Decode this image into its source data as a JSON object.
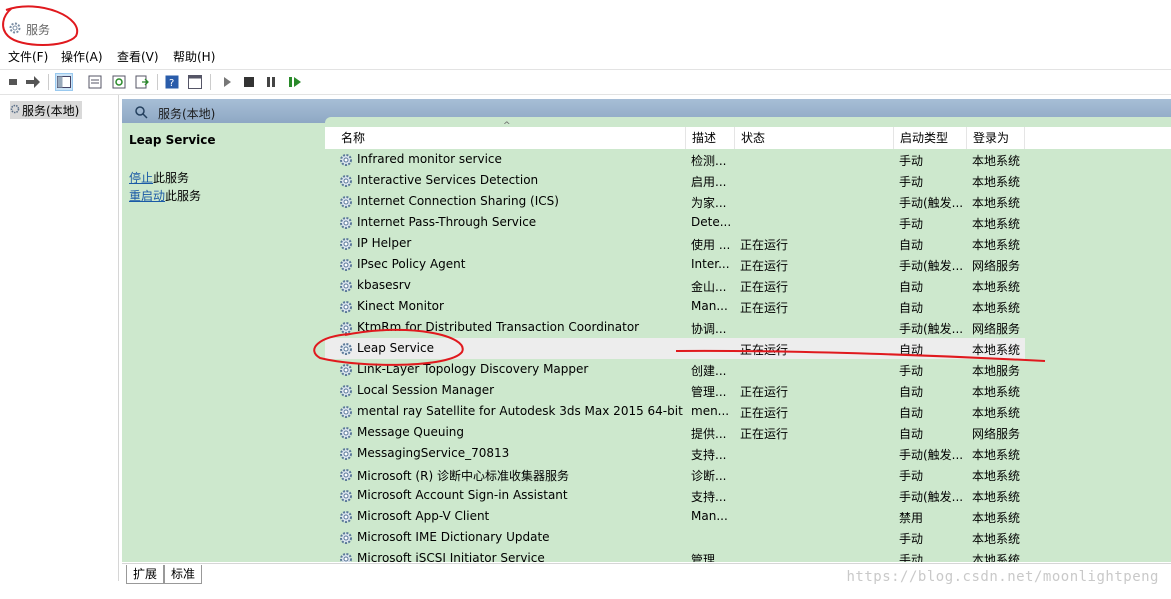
{
  "window": {
    "title": "服务"
  },
  "menu": [
    "文件(F)",
    "操作(A)",
    "查看(V)",
    "帮助(H)"
  ],
  "tree": {
    "root": "服务(本地)"
  },
  "panel": {
    "header": "服务(本地)"
  },
  "description": {
    "service_name": "Leap Service",
    "stop_link": "停止",
    "stop_suffix": "此服务",
    "restart_link": "重启动",
    "restart_suffix": "此服务"
  },
  "columns": {
    "name": "名称",
    "desc": "描述",
    "status": "状态",
    "startup": "启动类型",
    "logon": "登录为"
  },
  "services": [
    {
      "name": "Infrared monitor service",
      "desc": "检测...",
      "status": "",
      "startup": "手动",
      "logon": "本地系统"
    },
    {
      "name": "Interactive Services Detection",
      "desc": "启用...",
      "status": "",
      "startup": "手动",
      "logon": "本地系统"
    },
    {
      "name": "Internet Connection Sharing (ICS)",
      "desc": "为家...",
      "status": "",
      "startup": "手动(触发...",
      "logon": "本地系统"
    },
    {
      "name": "Internet Pass-Through Service",
      "desc": "Dete...",
      "status": "",
      "startup": "手动",
      "logon": "本地系统"
    },
    {
      "name": "IP Helper",
      "desc": "使用 ...",
      "status": "正在运行",
      "startup": "自动",
      "logon": "本地系统"
    },
    {
      "name": "IPsec Policy Agent",
      "desc": "Inter...",
      "status": "正在运行",
      "startup": "手动(触发...",
      "logon": "网络服务"
    },
    {
      "name": "kbasesrv",
      "desc": "金山...",
      "status": "正在运行",
      "startup": "自动",
      "logon": "本地系统"
    },
    {
      "name": "Kinect Monitor",
      "desc": "Man...",
      "status": "正在运行",
      "startup": "自动",
      "logon": "本地系统"
    },
    {
      "name": "KtmRm for Distributed Transaction Coordinator",
      "desc": "协调...",
      "status": "",
      "startup": "手动(触发...",
      "logon": "网络服务"
    },
    {
      "name": "Leap Service",
      "desc": "",
      "status": "正在运行",
      "startup": "自动",
      "logon": "本地系统"
    },
    {
      "name": "Link-Layer Topology Discovery Mapper",
      "desc": "创建...",
      "status": "",
      "startup": "手动",
      "logon": "本地服务"
    },
    {
      "name": "Local Session Manager",
      "desc": "管理...",
      "status": "正在运行",
      "startup": "自动",
      "logon": "本地系统"
    },
    {
      "name": "mental ray Satellite for Autodesk 3ds Max 2015 64-bit",
      "desc": "men...",
      "status": "正在运行",
      "startup": "自动",
      "logon": "本地系统"
    },
    {
      "name": "Message Queuing",
      "desc": "提供...",
      "status": "正在运行",
      "startup": "自动",
      "logon": "网络服务"
    },
    {
      "name": "MessagingService_70813",
      "desc": "支持...",
      "status": "",
      "startup": "手动(触发...",
      "logon": "本地系统"
    },
    {
      "name": "Microsoft (R) 诊断中心标准收集器服务",
      "desc": "诊断...",
      "status": "",
      "startup": "手动",
      "logon": "本地系统"
    },
    {
      "name": "Microsoft Account Sign-in Assistant",
      "desc": "支持...",
      "status": "",
      "startup": "手动(触发...",
      "logon": "本地系统"
    },
    {
      "name": "Microsoft App-V Client",
      "desc": "Man...",
      "status": "",
      "startup": "禁用",
      "logon": "本地系统"
    },
    {
      "name": "Microsoft IME Dictionary Update",
      "desc": "",
      "status": "",
      "startup": "手动",
      "logon": "本地系统"
    },
    {
      "name": "Microsoft iSCSI Initiator Service",
      "desc": "管理...",
      "status": "",
      "startup": "手动",
      "logon": "本地系统"
    }
  ],
  "tabs": [
    "扩展",
    "标准"
  ],
  "watermark": "https://blog.csdn.net/moonlightpeng",
  "colors": {
    "panel_bg": "#cde8cd",
    "header_bg": "#9bb3cd",
    "annotation": "#e0191e"
  }
}
